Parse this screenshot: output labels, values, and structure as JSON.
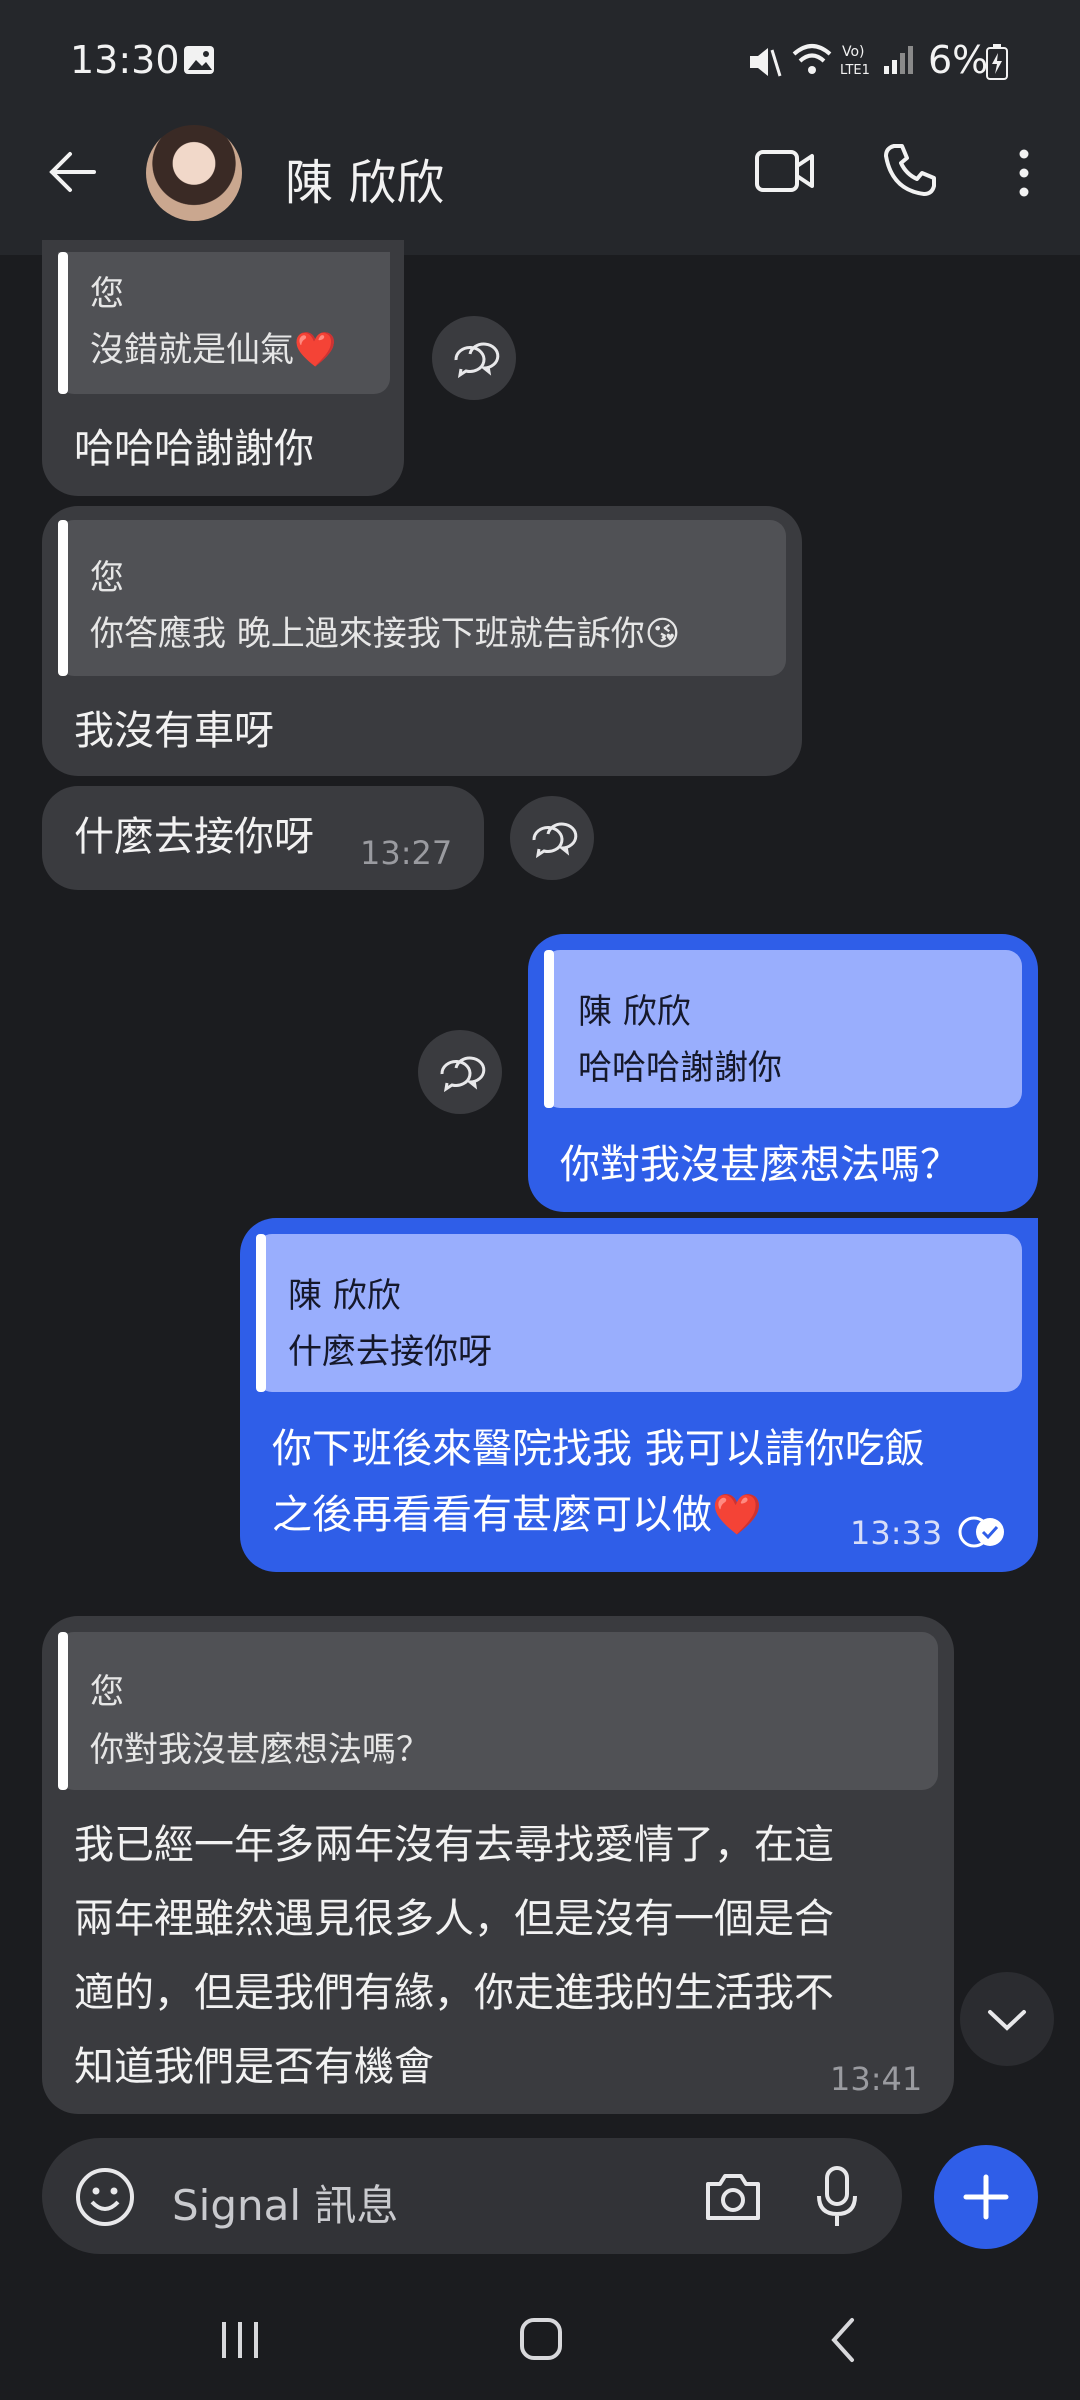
{
  "status_bar": {
    "time": "13:30",
    "battery": "6%"
  },
  "header": {
    "contact_name": "陳 欣欣"
  },
  "messages": [
    {
      "quote_author": "您",
      "quote_text": "沒錯就是仙氣❤️",
      "text": "哈哈哈謝謝你"
    },
    {
      "quote_author": "您",
      "quote_text": "你答應我 晚上過來接我下班就告訴你😘",
      "text": "我沒有車呀"
    },
    {
      "text": "什麼去接你呀",
      "time": "13:27"
    },
    {
      "quote_author": "陳 欣欣",
      "quote_text": "哈哈哈謝謝你",
      "text": "你對我沒甚麼想法嗎？"
    },
    {
      "quote_author": "陳 欣欣",
      "quote_text": "什麼去接你呀",
      "line1": "你下班後來醫院找我 我可以請你吃飯",
      "line2": "之後再看看有甚麼可以做❤️",
      "time": "13:33"
    },
    {
      "quote_author": "您",
      "quote_text": "你對我沒甚麼想法嗎？",
      "lines": [
        "我已經一年多兩年沒有去尋找愛情了，在這",
        "兩年裡雖然遇見很多人，但是沒有一個是合",
        "適的，但是我們有緣，你走進我的生活我不",
        "知道我們是否有機會"
      ],
      "time": "13:41"
    }
  ],
  "composer": {
    "placeholder": "Signal 訊息"
  },
  "icons": {
    "back": "arrow-left-icon",
    "video": "video-call-icon",
    "phone": "phone-call-icon",
    "more": "more-vertical-icon",
    "react": "reaction-icon",
    "scroll": "chevron-down-icon",
    "emoji": "emoji-icon",
    "camera": "camera-icon",
    "mic": "microphone-icon",
    "plus": "plus-icon",
    "read": "read-receipt-icon"
  },
  "colors": {
    "accent": "#2f5ee8",
    "incoming": "#3a3b3f",
    "background": "#1b1c1f"
  }
}
